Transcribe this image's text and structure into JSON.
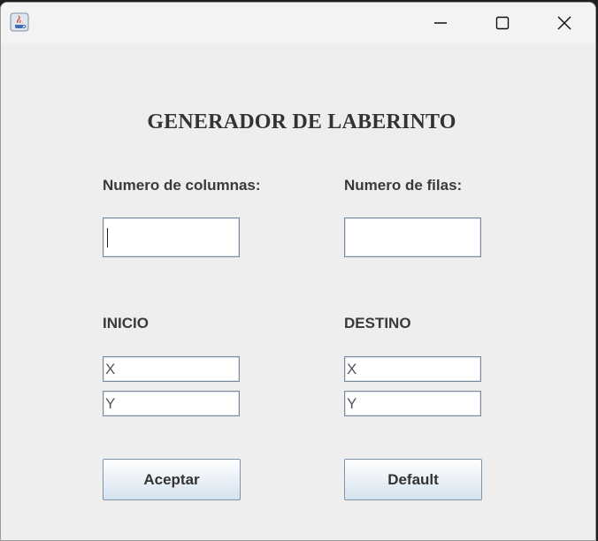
{
  "window": {
    "title": "",
    "controls": {
      "minimize": "minimize",
      "maximize": "maximize",
      "close": "close"
    }
  },
  "form": {
    "title": "GENERADOR DE LABERINTO",
    "columns_label": "Numero de columnas:",
    "columns_value": "",
    "rows_label": "Numero de filas:",
    "rows_value": "",
    "start_label": "INICIO",
    "start_x": "X",
    "start_y": "Y",
    "dest_label": "DESTINO",
    "dest_x": "X",
    "dest_y": "Y",
    "accept_button": "Aceptar",
    "default_button": "Default"
  },
  "icons": {
    "app": "java-cup-icon",
    "minimize": "minimize-icon",
    "maximize": "maximize-icon",
    "close": "close-icon"
  },
  "colors": {
    "window_bg": "#efeeef",
    "titlebar_bg": "#f3f3f3",
    "field_border": "#7a8a9c",
    "button_border": "#7f94ad",
    "text": "#333333"
  }
}
